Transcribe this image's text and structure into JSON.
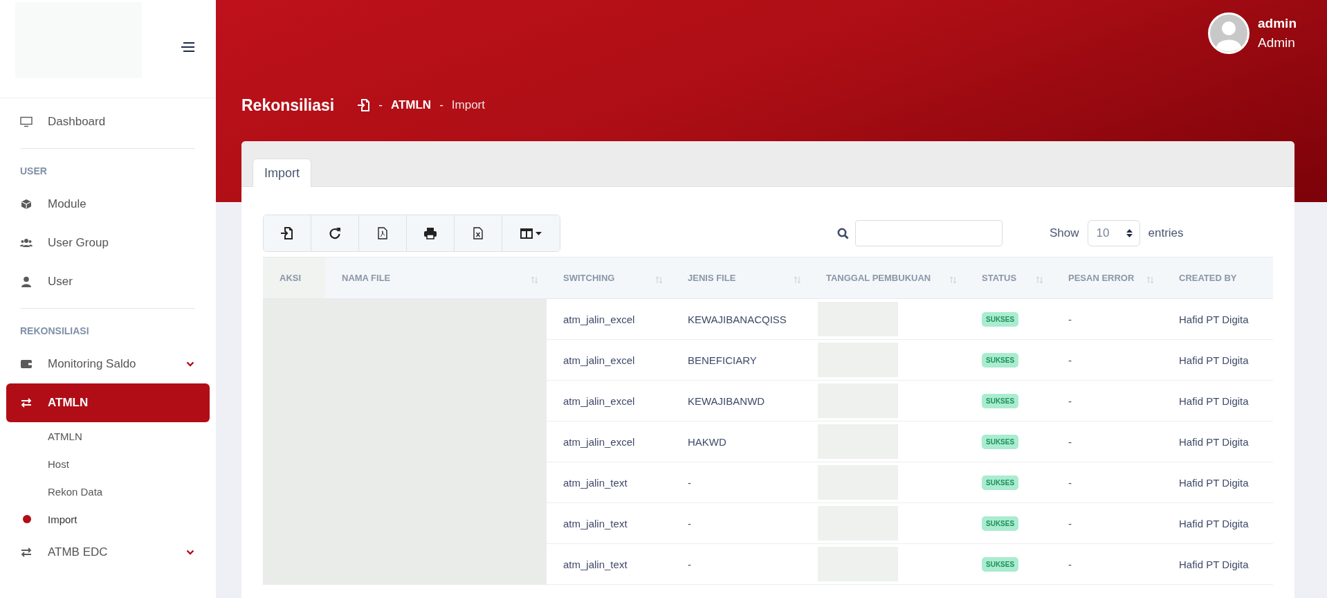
{
  "sidebar": {
    "sections": [
      {
        "items": [
          {
            "label": "Dashboard",
            "selected": false
          }
        ]
      },
      {
        "heading": "USER",
        "items": [
          {
            "label": "Module",
            "selected": false
          },
          {
            "label": "User Group",
            "selected": false
          },
          {
            "label": "User",
            "selected": false
          }
        ]
      },
      {
        "heading": "REKONSILIASI",
        "items": [
          {
            "label": "Monitoring Saldo",
            "selected": false,
            "expanded": false
          },
          {
            "label": "ATMLN",
            "selected": true,
            "expanded": true,
            "children": [
              {
                "label": "ATMLN",
                "selected": false
              },
              {
                "label": "Host",
                "selected": false
              },
              {
                "label": "Rekon Data",
                "selected": false
              },
              {
                "label": "Import",
                "selected": true
              }
            ]
          },
          {
            "label": "ATMB EDC",
            "selected": false,
            "expanded": false
          }
        ]
      }
    ]
  },
  "user": {
    "name": "admin",
    "role": "Admin"
  },
  "page": {
    "title": "Rekonsiliasi",
    "breadcrumb": [
      {
        "sep": "-",
        "label": "ATMLN",
        "selected": false
      },
      {
        "sep": "-",
        "label": "Import",
        "selected": true
      }
    ]
  },
  "tabs": [
    {
      "label": "Import",
      "selected": true
    }
  ],
  "length_menu": {
    "before": "Show",
    "value": "10",
    "after": "entries"
  },
  "table": {
    "columns": [
      {
        "label": "AKSI",
        "sortable": false
      },
      {
        "label": "NAMA FILE",
        "sortable": true
      },
      {
        "label": "SWITCHING",
        "sortable": true
      },
      {
        "label": "JENIS FILE",
        "sortable": true
      },
      {
        "label": "TANGGAL PEMBUKUAN",
        "sortable": true
      },
      {
        "label": "STATUS",
        "sortable": true
      },
      {
        "label": "PESAN ERROR",
        "sortable": true
      },
      {
        "label": "CREATED BY",
        "sortable": false
      }
    ],
    "rows": [
      {
        "switching": "atm_jalin_excel",
        "jenis_file": "KEWAJIBANACQISS",
        "status": "SUKSES",
        "pesan_error": "-",
        "created_by": "Hafid PT Digita"
      },
      {
        "switching": "atm_jalin_excel",
        "jenis_file": "BENEFICIARY",
        "status": "SUKSES",
        "pesan_error": "-",
        "created_by": "Hafid PT Digita"
      },
      {
        "switching": "atm_jalin_excel",
        "jenis_file": "KEWAJIBANWD",
        "status": "SUKSES",
        "pesan_error": "-",
        "created_by": "Hafid PT Digita"
      },
      {
        "switching": "atm_jalin_excel",
        "jenis_file": "HAKWD",
        "status": "SUKSES",
        "pesan_error": "-",
        "created_by": "Hafid PT Digita"
      },
      {
        "switching": "atm_jalin_text",
        "jenis_file": "-",
        "status": "SUKSES",
        "pesan_error": "-",
        "created_by": "Hafid PT Digita"
      },
      {
        "switching": "atm_jalin_text",
        "jenis_file": "-",
        "status": "SUKSES",
        "pesan_error": "-",
        "created_by": "Hafid PT Digita"
      },
      {
        "switching": "atm_jalin_text",
        "jenis_file": "-",
        "status": "SUKSES",
        "pesan_error": "-",
        "created_by": "Hafid PT Digita"
      }
    ]
  }
}
